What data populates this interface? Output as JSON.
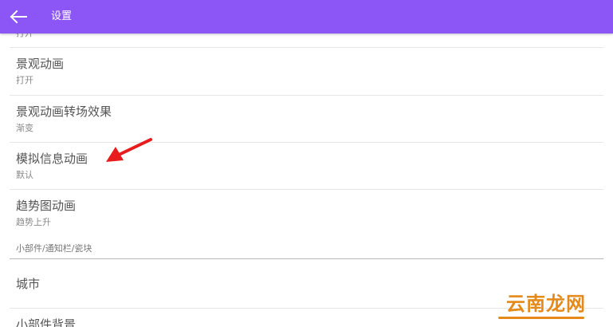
{
  "appbar": {
    "title": "设置",
    "back_icon": "arrow-left-icon",
    "color": "#8c55f5"
  },
  "settings": {
    "partial_top_summary": "打开",
    "items": [
      {
        "title": "景观动画",
        "summary": "打开"
      },
      {
        "title": "景观动画转场效果",
        "summary": "渐变"
      },
      {
        "title": "模拟信息动画",
        "summary": "默认"
      },
      {
        "title": "趋势图动画",
        "summary": "趋势上升"
      }
    ],
    "category": "小部件/通知栏/瓷块",
    "category_items": [
      {
        "title": "城市"
      },
      {
        "title": "小部件背景"
      }
    ]
  },
  "annotation": {
    "arrow_color": "#e81c1c"
  },
  "watermark": {
    "text": "云南龙网",
    "color": "#e58a1a"
  }
}
